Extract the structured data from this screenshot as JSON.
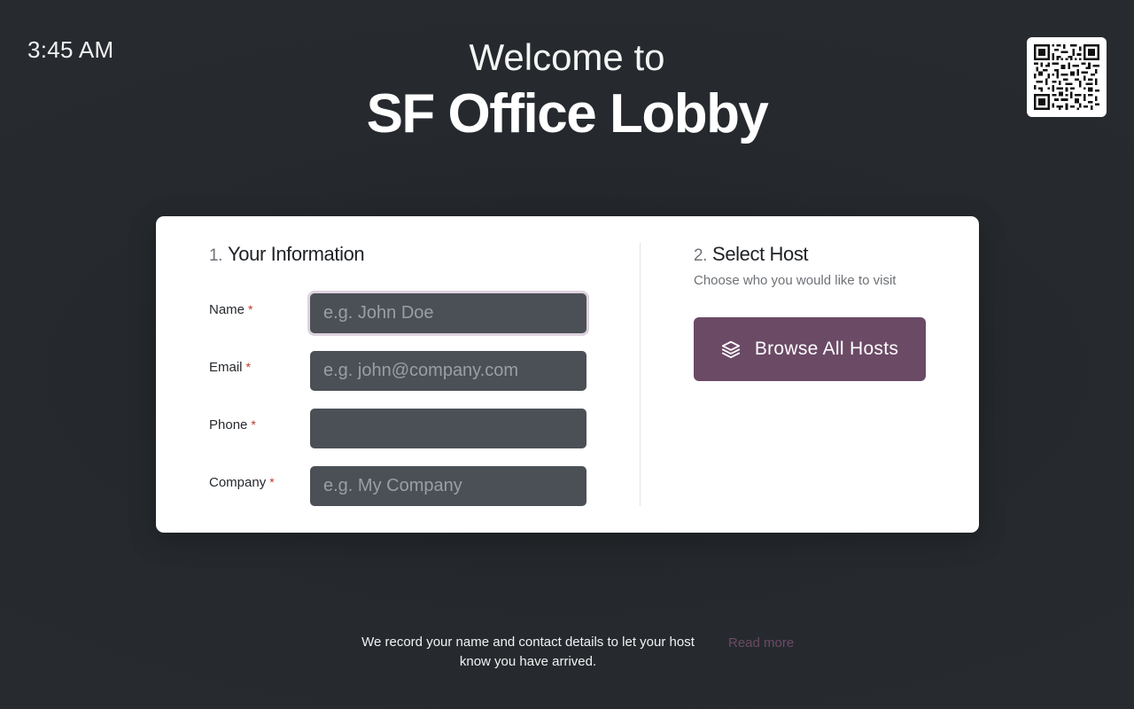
{
  "clock": {
    "time": "3:45 AM"
  },
  "header": {
    "welcome": "Welcome to",
    "location": "SF Office Lobby"
  },
  "info_section": {
    "number": "1.",
    "title": "Your Information",
    "required_mark": "*",
    "fields": [
      {
        "label": "Name",
        "placeholder": "e.g. John Doe",
        "value": "",
        "focused": true
      },
      {
        "label": "Email",
        "placeholder": "e.g. john@company.com",
        "value": ""
      },
      {
        "label": "Phone",
        "placeholder": "",
        "value": ""
      },
      {
        "label": "Company",
        "placeholder": "e.g. My Company",
        "value": ""
      }
    ]
  },
  "host_section": {
    "number": "2.",
    "title": "Select Host",
    "subtitle": "Choose who you would like to visit",
    "browse_button": {
      "label": "Browse All Hosts",
      "icon": "layers-icon"
    }
  },
  "footer": {
    "privacy_text": "We record your name and contact details to let your host know you have arrived.",
    "read_more": "Read more"
  },
  "colors": {
    "background": "#262a2e",
    "card": "#ffffff",
    "input": "#4b5056",
    "accent": "#6b4a66",
    "required": "#c0392b"
  }
}
